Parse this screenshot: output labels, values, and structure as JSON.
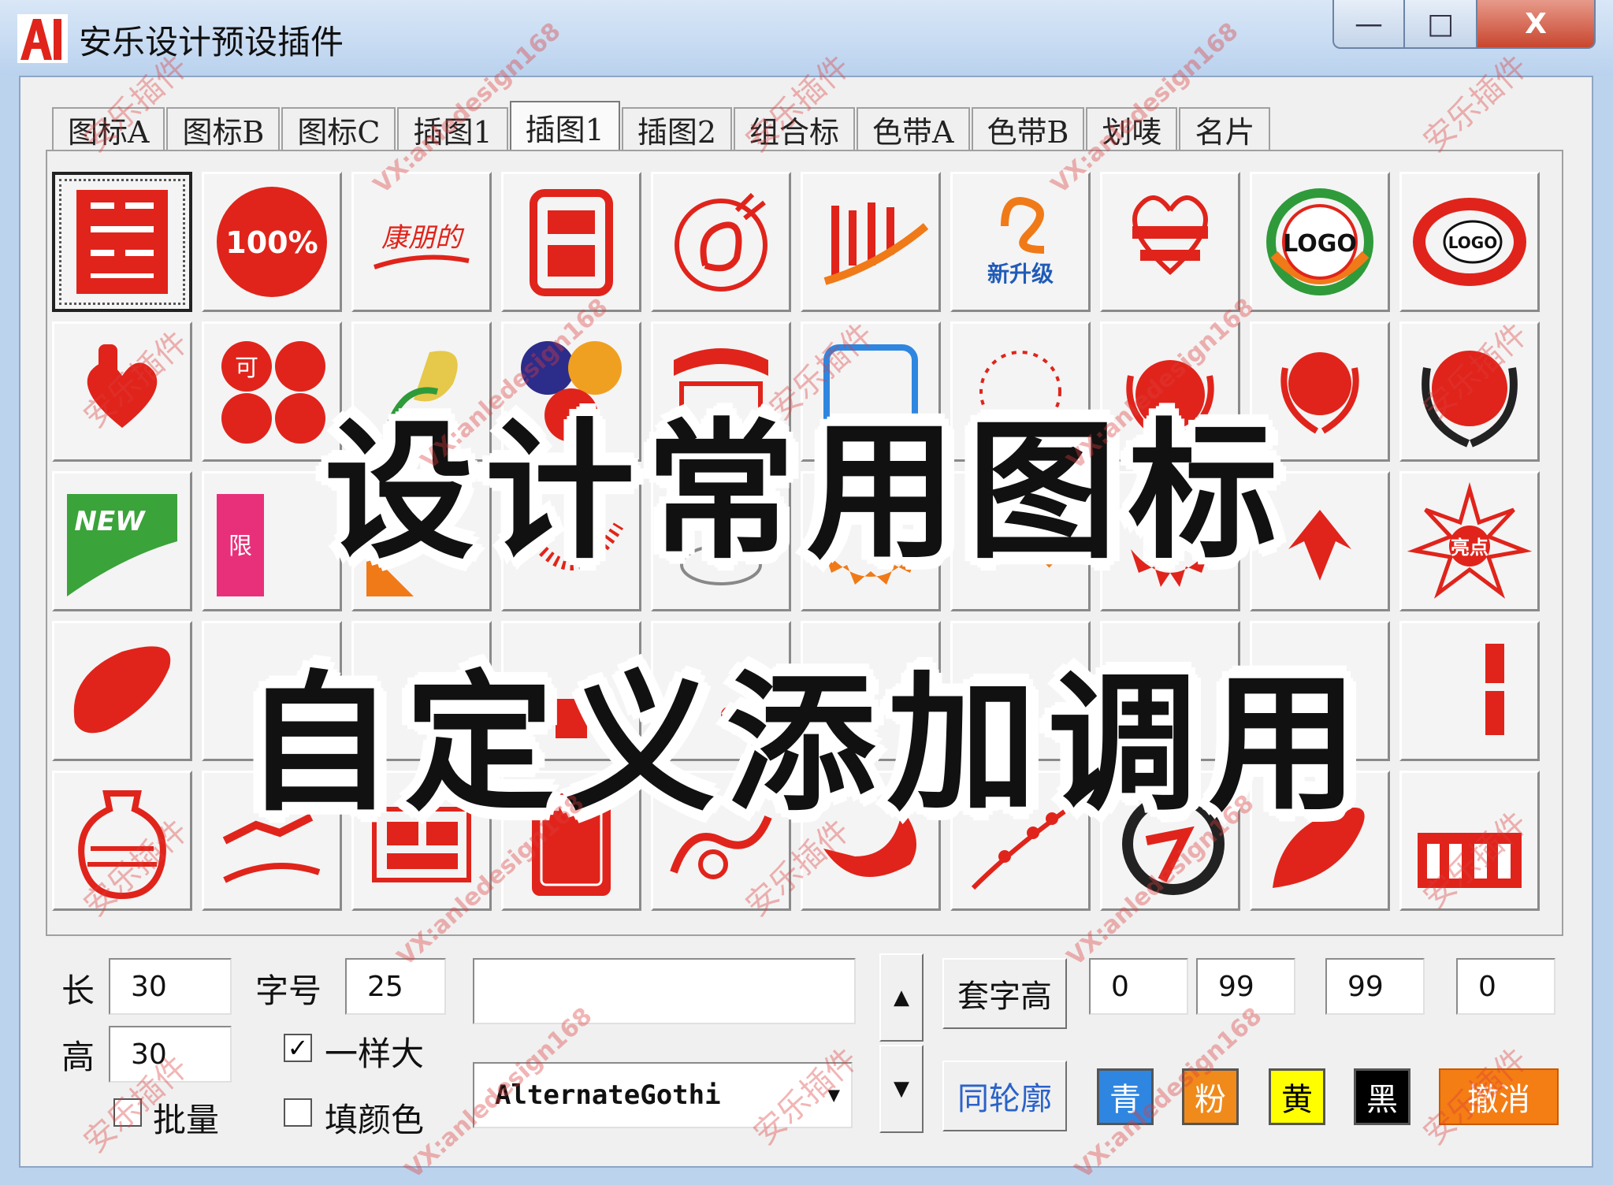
{
  "window": {
    "title": "安乐设计预设插件",
    "min_label": "—",
    "max_label": "□",
    "close_label": "X"
  },
  "tabs": [
    {
      "label": "图标A",
      "active": false
    },
    {
      "label": "图标B",
      "active": false
    },
    {
      "label": "图标C",
      "active": false
    },
    {
      "label": "插图1",
      "active": false
    },
    {
      "label": "插图1",
      "active": true
    },
    {
      "label": "插图2",
      "active": false
    },
    {
      "label": "组合标",
      "active": false
    },
    {
      "label": "色带A",
      "active": false
    },
    {
      "label": "色带B",
      "active": false
    },
    {
      "label": "划唛",
      "active": false
    },
    {
      "label": "名片",
      "active": false
    }
  ],
  "icon_labels": {
    "r1c2": "100%",
    "r1c3": "康朋的",
    "r1c7": "新升级",
    "r1c9": "LOGO",
    "r1c10": "LOGO",
    "r3c1": "NEW",
    "r3c2": "限",
    "r3c10": "亮点",
    "r2c2": "可"
  },
  "controls": {
    "length_label": "长",
    "length_value": "30",
    "height_label": "高",
    "height_value": "30",
    "fontsize_label": "字号",
    "fontsize_value": "25",
    "same_size_label": "一样大",
    "same_size_checked": "✓",
    "batch_label": "批量",
    "fill_color_label": "填颜色",
    "text_input_value": "",
    "font_select_value": "AlternateGothi",
    "up_arrow": "▲",
    "down_arrow": "▼",
    "fit_height_button": "套字高",
    "outline_button": "同轮廓",
    "cmyk": [
      "0",
      "99",
      "99",
      "0"
    ],
    "color_buttons": [
      {
        "label": "青",
        "bg": "#2f86e0",
        "fg": "#ffffff"
      },
      {
        "label": "粉",
        "bg": "#f08a1a",
        "fg": "#ffffff"
      },
      {
        "label": "黄",
        "bg": "#ffff00",
        "fg": "#000000"
      },
      {
        "label": "黑",
        "bg": "#000000",
        "fg": "#ffffff"
      }
    ],
    "cancel_button": "撤消",
    "cancel_bg": "#f47d14"
  },
  "overlay": {
    "line1": "设计常用图标",
    "line2": "自定义添加调用"
  },
  "watermarks": {
    "brand": "安乐插件",
    "contact": "VX:anledesign168"
  },
  "colors": {
    "accent_red": "#e0241b",
    "title_bar": "#bad2ee"
  }
}
